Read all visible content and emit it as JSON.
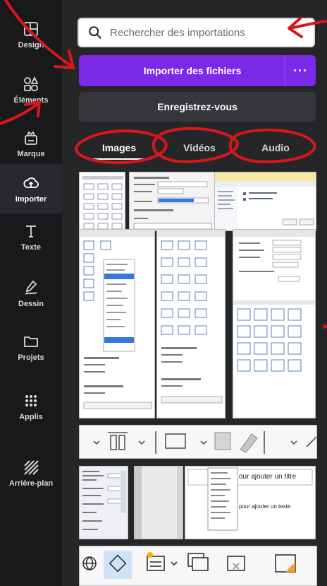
{
  "rail": {
    "items": [
      {
        "label": "Design",
        "icon": "design-layout-icon"
      },
      {
        "label": "Éléments",
        "icon": "elements-shapes-icon"
      },
      {
        "label": "Marque",
        "icon": "brand-crown-icon"
      },
      {
        "label": "Importer",
        "icon": "cloud-upload-icon",
        "active": true
      },
      {
        "label": "Texte",
        "icon": "text-t-icon"
      },
      {
        "label": "Dessin",
        "icon": "draw-pen-icon"
      },
      {
        "label": "Projets",
        "icon": "folder-icon"
      },
      {
        "label": "Applis",
        "icon": "apps-grid-icon"
      },
      {
        "label": "Arrière-plan",
        "icon": "background-stripes-icon"
      }
    ]
  },
  "search": {
    "placeholder": "Rechercher des importations"
  },
  "upload": {
    "label": "Importer des fichiers",
    "more_label": "···"
  },
  "record": {
    "label": "Enregistrez-vous"
  },
  "tabs": [
    {
      "label": "Images",
      "active": true
    },
    {
      "label": "Vidéos"
    },
    {
      "label": "Audio"
    }
  ],
  "thumb_text": {
    "title_placeholder": "our ajouter un titre",
    "text_placeholder": "pour ajouter un texte"
  },
  "colors": {
    "background_teal": "#67c4cf",
    "rail": "#18191b",
    "panel": "#252627",
    "primary_purple": "#7d2ae8",
    "annotation_red": "#d8161b"
  }
}
